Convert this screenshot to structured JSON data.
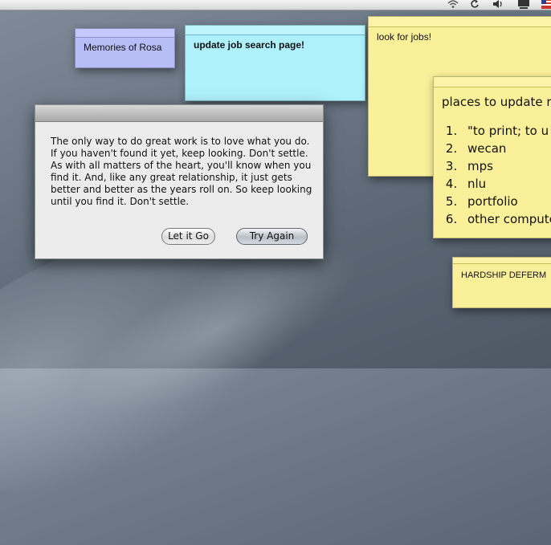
{
  "menubar": {
    "icons": [
      "wifi-icon",
      "sync-icon",
      "volume-icon",
      "display-icon",
      "flag-icon"
    ]
  },
  "notes": {
    "memories": "Memories of Rosa",
    "job_search": "update job search page!",
    "look_for_jobs": "look for jobs!",
    "places": {
      "title": "places to update re",
      "items": [
        "\"to print; to u",
        "wecan",
        "mps",
        "nlu",
        "portfolio",
        "other compute"
      ]
    },
    "hardship": "HARDSHIP DEFERM"
  },
  "dialog": {
    "message": "The only way to do great work is to love what you do. If you haven't found it yet, keep looking. Don't settle. As with all matters of the heart, you'll know when you find it. And, like any great relationship, it just gets better and better as the years roll on. So keep looking until you find it. Don't settle.",
    "buttons": {
      "let_it_go": "Let it Go",
      "try_again": "Try Again"
    }
  },
  "colors": {
    "note_blue": "#b6bdf7",
    "note_cyan": "#aef0fb",
    "note_yellow": "#fbf09a",
    "desktop": "#6b7785"
  }
}
